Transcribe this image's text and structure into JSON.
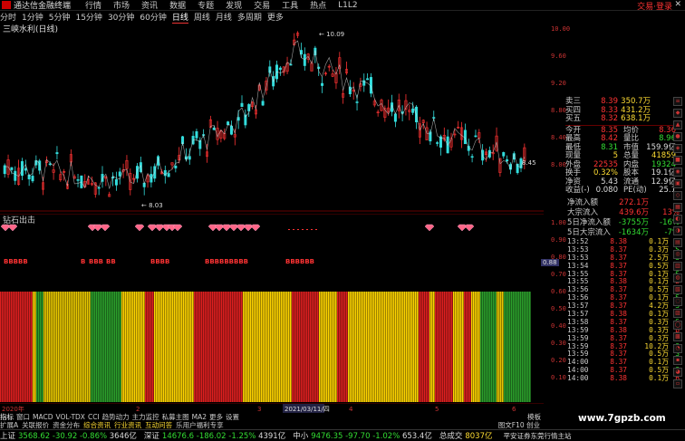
{
  "menubar": {
    "app_title": "通达信金融终端",
    "items": [
      "行情",
      "市场",
      "资讯",
      "数据",
      "专题",
      "发现",
      "交易",
      "工具",
      "热点",
      "L1L2"
    ],
    "login": "交易·登录"
  },
  "periodbar": {
    "items": [
      "分时",
      "1分钟",
      "5分钟",
      "15分钟",
      "30分钟",
      "60分钟",
      "日线",
      "周线",
      "月线",
      "多周期",
      "更多"
    ],
    "active": "日线"
  },
  "stock_title": "三峡水利(日线)",
  "chart": {
    "high_label": "10.09",
    "low_label": "8.03",
    "right_marker": "8.45",
    "yaxis": [
      "10.00",
      "9.60",
      "9.20",
      "8.80",
      "8.40",
      "8.00"
    ],
    "events": [
      "增",
      "财",
      "8"
    ],
    "colors": {
      "up": "#ff3333",
      "down": "#33dddd",
      "ma1": "#dddddd",
      "ma2": "#ffdd33"
    }
  },
  "quote": {
    "rows": [
      {
        "l": "卖三",
        "v": "8.39",
        "v2": "350.7万",
        "c": "red"
      },
      {
        "l": "买四",
        "v": "8.33",
        "v2": "431.2万",
        "c": "red"
      },
      {
        "l": "买五",
        "v": "8.32",
        "v2": "638.1万",
        "c": "red"
      }
    ],
    "stats": [
      {
        "l1": "今开",
        "v1": "8.35",
        "c1": "red",
        "l2": "均价",
        "v2": "8.36",
        "c2": "red"
      },
      {
        "l1": "最高",
        "v1": "8.42",
        "c1": "red",
        "l2": "量比",
        "v2": "8.96",
        "c2": "green"
      },
      {
        "l1": "最低",
        "v1": "8.31",
        "c1": "green",
        "l2": "市值",
        "v2": "159.9亿",
        "c2": "white"
      },
      {
        "l1": "现量",
        "v1": "5",
        "c1": "yellow",
        "l2": "总量",
        "v2": "41859",
        "c2": "yellow"
      },
      {
        "l1": "外盘",
        "v1": "22535",
        "c1": "red",
        "l2": "内盘",
        "v2": "19324",
        "c2": "green"
      },
      {
        "l1": "换手",
        "v1": "0.32%",
        "c1": "yellow",
        "l2": "股本",
        "v2": "19.1亿",
        "c2": "white"
      },
      {
        "l1": "净资",
        "v1": "5.43",
        "c1": "white",
        "l2": "流通",
        "v2": "12.9亿",
        "c2": "white"
      },
      {
        "l1": "收益(-)",
        "v1": "0.080",
        "c1": "white",
        "l2": "PE(动)",
        "v2": "25.1",
        "c2": "white"
      }
    ]
  },
  "flow": [
    {
      "l": "净流入额",
      "v": "272.1万",
      "p": "",
      "c": "red"
    },
    {
      "l": "大宗流入",
      "v": "439.6万",
      "p": "13%",
      "c": "red"
    },
    {
      "l": "5日净流入额",
      "v": "-3755万",
      "p": "-16%",
      "c": "green"
    },
    {
      "l": "5日大宗流入",
      "v": "-1634万",
      "p": "-7%",
      "c": "green"
    }
  ],
  "ticks": [
    {
      "t": "13:52",
      "p": "8.38",
      "v": "0.1万",
      "s": "B"
    },
    {
      "t": "13:53",
      "p": "8.37",
      "v": "0.3万",
      "s": "S"
    },
    {
      "t": "13:53",
      "p": "8.37",
      "v": "2.5万",
      "s": "S"
    },
    {
      "t": "13:54",
      "p": "8.37",
      "v": "0.5万",
      "s": "S"
    },
    {
      "t": "13:55",
      "p": "8.37",
      "v": "0.1万",
      "s": "S"
    },
    {
      "t": "13:55",
      "p": "8.38",
      "v": "0.1万",
      "s": "B"
    },
    {
      "t": "13:56",
      "p": "8.37",
      "v": "0.5万",
      "s": "S"
    },
    {
      "t": "13:56",
      "p": "8.37",
      "v": "0.1万",
      "s": "S"
    },
    {
      "t": "13:57",
      "p": "8.37",
      "v": "4.2万",
      "s": "S"
    },
    {
      "t": "13:57",
      "p": "8.38",
      "v": "0.1万",
      "s": "B"
    },
    {
      "t": "13:58",
      "p": "8.37",
      "v": "0.3万",
      "s": "S"
    },
    {
      "t": "13:59",
      "p": "8.38",
      "v": "0.3万",
      "s": "B"
    },
    {
      "t": "13:59",
      "p": "8.37",
      "v": "0.3万",
      "s": "S"
    },
    {
      "t": "13:59",
      "p": "8.37",
      "v": "10.2万",
      "s": "S"
    },
    {
      "t": "13:59",
      "p": "8.37",
      "v": "0.5万",
      "s": "S"
    },
    {
      "t": "14:00",
      "p": "8.37",
      "v": "0.1万",
      "s": "S"
    },
    {
      "t": "14:00",
      "p": "8.37",
      "v": "0.5万",
      "s": "S"
    },
    {
      "t": "14:00",
      "p": "8.38",
      "v": "0.1万",
      "s": "B"
    }
  ],
  "indicator1": {
    "label": "钻石出击",
    "diamond_text": "BBBBB",
    "side_value": "0.88",
    "yaxis": [
      "1.00",
      "0.90",
      "0.80",
      "0.70",
      "0.60",
      "0.50",
      "0.40",
      "0.30",
      "0.20",
      "0.10"
    ]
  },
  "xaxis": {
    "labels": [
      "2020年",
      "2",
      "3",
      "4",
      "5",
      "6"
    ],
    "cursor_date": "2021/03/11/四"
  },
  "tabs1": {
    "items": [
      "指标",
      "窗口",
      "MACD",
      "VOL-TDX",
      "CCI",
      "趋势动力",
      "主力监控",
      "私募主图",
      "MA2",
      "更多",
      "设置"
    ],
    "right": "模板"
  },
  "tabs2": {
    "items": [
      "扩展A",
      "关联报价",
      "资金分布",
      "综合资讯",
      "行业资讯",
      "互动问答",
      "乐用户福利专享"
    ],
    "right": "图文F10 创业"
  },
  "status": [
    {
      "n": "上证",
      "v": "3568.62",
      "d": "-30.92",
      "p": "-0.86%",
      "a": "3646亿"
    },
    {
      "n": "深证",
      "v": "14676.6",
      "d": "-186.02",
      "p": "-1.25%",
      "a": "4391亿"
    },
    {
      "n": "中小",
      "v": "9476.35",
      "d": "-97.70",
      "p": "-1.02%",
      "a": "653.4亿"
    },
    {
      "n": "总成交",
      "v": "8037亿",
      "d": "",
      "p": "",
      "a": ""
    }
  ],
  "status_right": "平安证券东莞行情主站",
  "watermark": "www.7gpzb.com"
}
